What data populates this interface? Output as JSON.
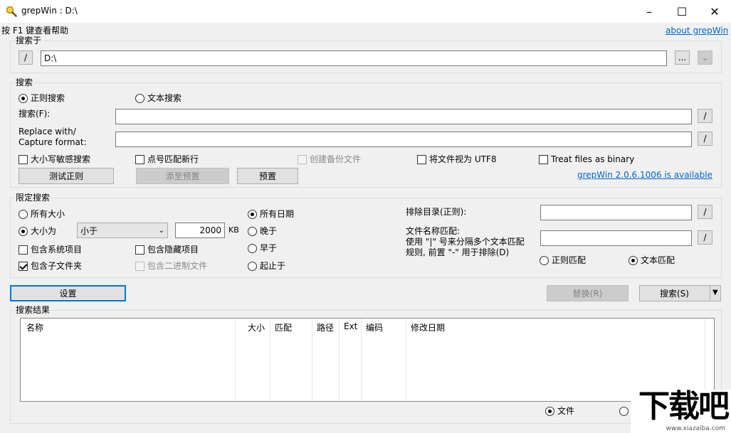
{
  "window": {
    "title": "grepWin : D:\\",
    "minimize": "–",
    "maximize": "☐",
    "close": "✕"
  },
  "help_text": "按 F1 键查看帮助",
  "about_link": "about grepWin",
  "search_in": {
    "group_label": "搜索于",
    "slash_button": "/",
    "path_value": "D:\\",
    "browse_button": "...",
    "dropdown_button": "⌄"
  },
  "search": {
    "group_label": "搜索",
    "regex_radio": "正则搜索",
    "text_radio": "文本搜索",
    "search_label": "搜索(F):",
    "replace_label_1": "Replace with/",
    "replace_label_2": "Capture format:",
    "search_value": "",
    "replace_value": "",
    "slash": "/",
    "case_sensitive": "大小写敏感搜索",
    "dot_newline": "点号匹配新行",
    "create_backup": "创建备份文件",
    "treat_utf8": "将文件视为 UTF8",
    "treat_binary": "Treat files as binary",
    "test_regex_button": "测试正则",
    "add_preset_button": "添至预置",
    "preset_button": "预置",
    "update_link": "grepWin 2.0.6.1006 is available"
  },
  "limit": {
    "group_label": "限定搜索",
    "all_sizes": "所有大小",
    "size_is": "大小为",
    "size_op": "小于",
    "size_value": "2000",
    "size_unit": "KB",
    "include_system": "包含系统项目",
    "include_hidden": "包含隐藏项目",
    "include_subfolders": "包含子文件夹",
    "include_binary": "包含二进制文件",
    "all_dates": "所有日期",
    "newer_than": "晚于",
    "older_than": "早于",
    "between": "起止于",
    "exclude_dirs_label": "排除目录(正则):",
    "exclude_dirs_value": "",
    "file_match_label_1": "文件名称匹配:",
    "file_match_label_2": "使用 \"|\" 号来分隔多个文本匹配",
    "file_match_label_3": "规则, 前置 \"-\" 用于排除(D)",
    "file_match_value": "",
    "regex_match": "正则匹配",
    "text_match": "文本匹配",
    "slash": "/"
  },
  "actions": {
    "settings_button": "设置",
    "replace_button": "替换(R)",
    "search_button": "搜索(S)",
    "search_dropdown": "▼"
  },
  "results": {
    "group_label": "搜索结果",
    "columns": [
      "名称",
      "大小",
      "匹配",
      "路径",
      "Ext",
      "编码",
      "修改日期"
    ],
    "files_radio": "文件",
    "content_radio": "内"
  },
  "watermark": {
    "brand": "下载吧",
    "url": "www.xiazaiba.com"
  }
}
